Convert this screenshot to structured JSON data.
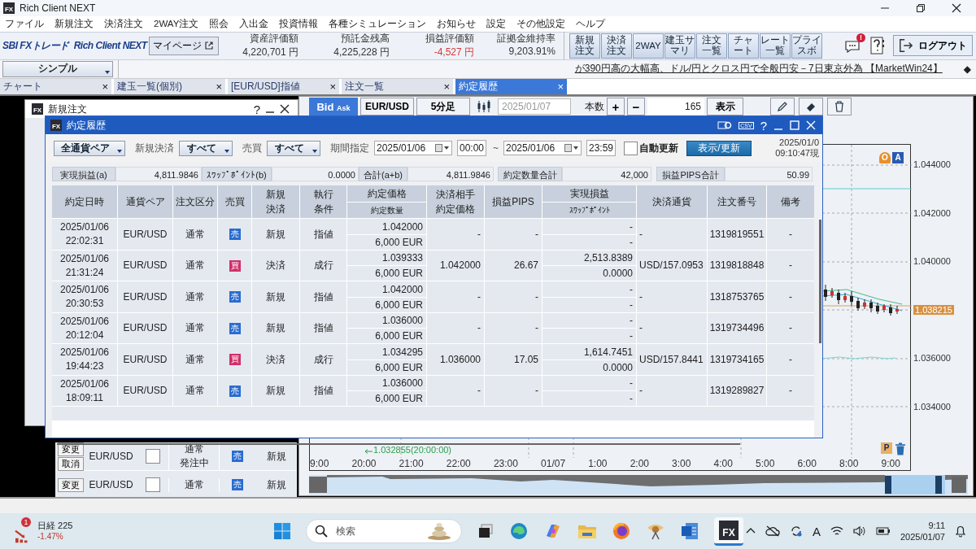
{
  "app": {
    "icon_label": "FX",
    "title": "Rich Client NEXT"
  },
  "menu": [
    "ファイル",
    "新規注文",
    "決済注文",
    "2WAY注文",
    "照会",
    "入出金",
    "投資情報",
    "各種シミュレーション",
    "お知らせ",
    "設定",
    "その他設定",
    "ヘルプ"
  ],
  "header": {
    "company_logo": "SBI FXトレード",
    "product_logo": "Rich Client NEXT",
    "mypage_button": "マイページ",
    "stats": [
      {
        "label": "資産評価額",
        "value": "4,220,701 円",
        "negative": false
      },
      {
        "label": "預託金残高",
        "value": "4,225,228 円",
        "negative": false
      },
      {
        "label": "損益評価額",
        "value": "-4,527 円",
        "negative": true
      },
      {
        "label": "証拠金維持率",
        "value": "9,203.91%",
        "negative": false
      }
    ],
    "quick_buttons": [
      "新規注文",
      "決済注文",
      "2WAY",
      "建玉サマリ",
      "注文一覧",
      "チャート",
      "レート一覧",
      "プライスボ"
    ],
    "notification_badge": "!",
    "logout_button": "ログアウト"
  },
  "toolbar": {
    "layout_select": "シンプル",
    "news": "が390円高の大幅高、ドル/円とクロス円で全般円安－7日東京外為 【MarketWin24】",
    "news_marker": "◆"
  },
  "tabs": [
    {
      "label": "チャート",
      "close": "×",
      "selected": false
    },
    {
      "label": "建玉一覧(個別)",
      "close": "×",
      "selected": false
    },
    {
      "label": "[EUR/USD]指値",
      "close": "×",
      "selected": false
    },
    {
      "label": "注文一覧",
      "close": "×",
      "selected": false
    },
    {
      "label": "約定履歴",
      "close": "×",
      "selected": true
    }
  ],
  "order_window": {
    "icon_label": "FX",
    "title": "新規注文",
    "help": "?",
    "rows": [
      {
        "buttons": [
          "変更",
          "取消"
        ],
        "pair": "EUR/USD",
        "checked": false,
        "type": "通常",
        "status": "発注中",
        "side": "売",
        "color": "#2a6cd0",
        "open_close": "新規"
      },
      {
        "buttons": [
          "変更"
        ],
        "pair": "EUR/USD",
        "checked": false,
        "type": "通常",
        "side": "売",
        "color": "#2a6cd0",
        "open_close": "新規"
      }
    ]
  },
  "chart_window": {
    "price_side": "Bid",
    "price_side_sub": "Ask",
    "pair": "EUR/USD",
    "timeframe": "5分足",
    "date": "2025/01/07",
    "count_label": "本数",
    "plus": "+",
    "minus": "−",
    "count": "165",
    "show_button": "表示",
    "order_marker": "O",
    "alert_marker": "A",
    "position_marker": "P",
    "y_labels": [
      {
        "text": "1.044000",
        "kind": "tick"
      },
      {
        "text": "1.042000",
        "kind": "tick"
      },
      {
        "text": "1.040000",
        "kind": "tick"
      },
      {
        "text": "1.038215",
        "kind": "current"
      },
      {
        "text": "1.036000",
        "kind": "tick"
      },
      {
        "text": "1.034000",
        "kind": "tick"
      }
    ],
    "x_labels": [
      "9:00",
      "20:00",
      "21:00",
      "22:00",
      "23:00",
      "01/07",
      "1:00",
      "2:00",
      "3:00",
      "4:00",
      "5:00",
      "6:00",
      "8:00",
      "9:00"
    ],
    "annotation": "1.032855(20:00:00)"
  },
  "dialog": {
    "icon_label": "FX",
    "title": "約定履歴",
    "csv_label": "CSV",
    "help": "?",
    "filters": {
      "pair_select": "全通貨ペア",
      "open_close_label": "新規決済",
      "open_close_select": "すべて",
      "side_label": "売買",
      "side_select": "すべて",
      "period_label": "期間指定",
      "from_date": "2025/01/06",
      "from_time": "00:00",
      "separator": "~",
      "to_date": "2025/01/06",
      "to_time": "23:59",
      "auto_refresh": {
        "label": "自動更新",
        "checked": false
      },
      "refresh_button": "表示/更新"
    },
    "timestamp": [
      "2025/01/0",
      "09:10:47現"
    ],
    "summary": [
      {
        "label": "実現損益(a)",
        "value": "4,811.9846"
      },
      {
        "label": "ｽﾜｯﾌﾟﾎﾟｲﾝﾄ(b)",
        "value": "0.0000"
      },
      {
        "label": "合計(a+b)",
        "value": "4,811.9846"
      },
      {
        "label": "約定数量合計",
        "value": "42,000"
      },
      {
        "label": "損益PIPS合計",
        "value": "50.99"
      }
    ],
    "columns": [
      {
        "kind": "single",
        "label": "約定日時"
      },
      {
        "kind": "single",
        "label": "通貨ペア"
      },
      {
        "kind": "single",
        "label": "注文区分"
      },
      {
        "kind": "single",
        "label": "売買"
      },
      {
        "kind": "single",
        "label": "新規決済"
      },
      {
        "kind": "single",
        "label": "執行条件"
      },
      {
        "kind": "split",
        "top": "約定価格",
        "bottom": "約定数量"
      },
      {
        "kind": "single",
        "label": "決済相手約定価格"
      },
      {
        "kind": "single",
        "label": "損益PIPS"
      },
      {
        "kind": "split",
        "top": "実現損益",
        "bottom": "ｽﾜｯﾌﾟﾎﾟｲﾝﾄ"
      },
      {
        "kind": "single",
        "label": "決済通貨"
      },
      {
        "kind": "single",
        "label": "注文番号"
      },
      {
        "kind": "single",
        "label": "備考"
      }
    ],
    "rows": [
      {
        "date": "2025/01/06",
        "time": "22:02:31",
        "pair": "EUR/USD",
        "type": "通常",
        "side": "売",
        "color": "#2a6cd0",
        "open_close": "新規",
        "exec": "指値",
        "price": "1.042000",
        "qty": "6,000 EUR",
        "counter_price": "-",
        "pips": "-",
        "pnl": "-",
        "swap": "-",
        "currency": "-",
        "order_no": "1319819551",
        "note": "-"
      },
      {
        "date": "2025/01/06",
        "time": "21:31:24",
        "pair": "EUR/USD",
        "type": "通常",
        "side": "買",
        "color": "#d0306a",
        "open_close": "決済",
        "exec": "成行",
        "price": "1.039333",
        "qty": "6,000 EUR",
        "counter_price": "1.042000",
        "pips": "26.67",
        "pnl": "2,513.8389",
        "swap": "0.0000",
        "currency": "USD/157.0953",
        "order_no": "1319818848",
        "note": "-"
      },
      {
        "date": "2025/01/06",
        "time": "20:30:53",
        "pair": "EUR/USD",
        "type": "通常",
        "side": "売",
        "color": "#2a6cd0",
        "open_close": "新規",
        "exec": "指値",
        "price": "1.042000",
        "qty": "6,000 EUR",
        "counter_price": "-",
        "pips": "-",
        "pnl": "-",
        "swap": "-",
        "currency": "-",
        "order_no": "1318753765",
        "note": "-"
      },
      {
        "date": "2025/01/06",
        "time": "20:12:04",
        "pair": "EUR/USD",
        "type": "通常",
        "side": "売",
        "color": "#2a6cd0",
        "open_close": "新規",
        "exec": "指値",
        "price": "1.036000",
        "qty": "6,000 EUR",
        "counter_price": "-",
        "pips": "-",
        "pnl": "-",
        "swap": "-",
        "currency": "-",
        "order_no": "1319734496",
        "note": "-"
      },
      {
        "date": "2025/01/06",
        "time": "19:44:23",
        "pair": "EUR/USD",
        "type": "通常",
        "side": "買",
        "color": "#d0306a",
        "open_close": "決済",
        "exec": "成行",
        "price": "1.034295",
        "qty": "6,000 EUR",
        "counter_price": "1.036000",
        "pips": "17.05",
        "pnl": "1,614.7451",
        "swap": "0.0000",
        "currency": "USD/157.8441",
        "order_no": "1319734165",
        "note": "-"
      },
      {
        "date": "2025/01/06",
        "time": "18:09:11",
        "pair": "EUR/USD",
        "type": "通常",
        "side": "売",
        "color": "#2a6cd0",
        "open_close": "新規",
        "exec": "指値",
        "price": "1.036000",
        "qty": "6,000 EUR",
        "counter_price": "-",
        "pips": "-",
        "pnl": "-",
        "swap": "-",
        "currency": "-",
        "order_no": "1319289827",
        "note": "-"
      }
    ]
  },
  "taskbar": {
    "widget_badge": "1",
    "widget_title": "日経 225",
    "widget_change": "-1.47%",
    "search_placeholder": "検索",
    "fx_label": "FX",
    "ime": "A",
    "time": "9:11",
    "date": "2025/01/07"
  }
}
